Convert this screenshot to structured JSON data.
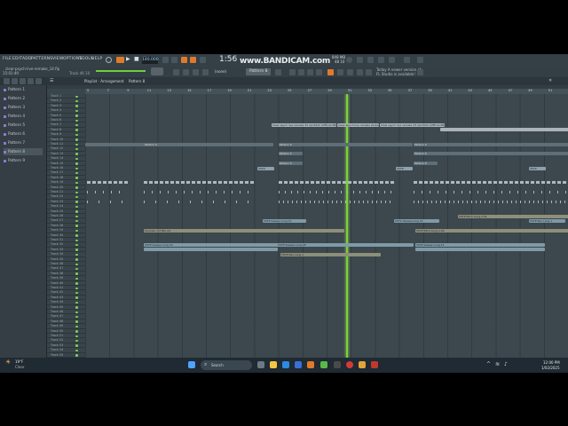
{
  "watermark": "www.BANDICAM.com",
  "menu": {
    "items": [
      "FILE",
      "EDIT",
      "ADD",
      "PATTERNS",
      "VIEW",
      "OPTIONS",
      "TOOLS",
      "HELP"
    ]
  },
  "transport": {
    "tempo": "140.000",
    "time": "1:56",
    "pattern_label": "Pattern 8",
    "snap_label": "(none)"
  },
  "hint_bar": {
    "file": "clear-psych-live-remake_14.flp",
    "time": "15:01:49",
    "track_hint": "Track 46 10"
  },
  "news": {
    "line1": "Today  A newer version of",
    "line2": "FL Studio is available!"
  },
  "monitor": {
    "mem": "848 MB",
    "cpu": "48 10"
  },
  "playlist": {
    "title": "Playlist - Arrangement",
    "pattern": "Pattern 8",
    "ruler": [
      "5",
      "7",
      "9",
      "11",
      "13",
      "15",
      "17",
      "19",
      "21",
      "23",
      "25",
      "27",
      "29",
      "31",
      "33",
      "35",
      "37",
      "39",
      "41",
      "43",
      "45",
      "47",
      "49",
      "51"
    ]
  },
  "patterns": [
    "Pattern 1",
    "Pattern 2",
    "Pattern 3",
    "Pattern 4",
    "Pattern 5",
    "Pattern 6",
    "Pattern 7",
    "Pattern 8",
    "Pattern 9"
  ],
  "selected_pattern": "Pattern 8",
  "tracks": [
    "Track 1",
    "Track 2",
    "Track 3",
    "Track 4",
    "Track 5",
    "Track 6",
    "Track 7",
    "Track 8",
    "Track 9",
    "Track 10",
    "Track 11",
    "Track 12",
    "Track 13",
    "Track 14",
    "Track 15",
    "Track 16",
    "Track 17",
    "Track 18",
    "Track 19",
    "Track 20",
    "Track 21",
    "Track 22",
    "Track 23",
    "Track 24",
    "Track 25",
    "Track 26",
    "Track 27",
    "Track 28",
    "Track 29",
    "Track 30",
    "Track 31",
    "Track 32",
    "Track 33",
    "Track 34",
    "Track 35",
    "Track 36",
    "Track 37",
    "Track 38",
    "Track 39",
    "Track 40",
    "Track 41",
    "Track 42",
    "Track 43",
    "Track 44",
    "Track 45",
    "Track 46",
    "Track 47",
    "Track 48",
    "Track 49",
    "Track 50",
    "Track 51",
    "Track 52",
    "Track 53",
    "Track 54",
    "Track 55"
  ],
  "clips": {
    "audio_a": "Claw spych live remake 32 Apr2022 (Official PROMO) wav",
    "audio_b": "Clear spych live remake (Kuba) spych",
    "audio_c": "Claw spych live remake 33 Apr2022 (Official PROMO) wav",
    "pattern_clip": "Pattern 4",
    "pattern_8": "Pattern 8",
    "pattern_9": "Pattern 9",
    "pattern_5": "Pattern 5",
    "pattern_6": "Pattern 6",
    "auto_vst": "VSTP",
    "auto_a": "VSTP Pitch Long 2.01",
    "auto_b": "VSTP Sweep Long 21",
    "auto_c": "VST2 Sweep Long 15",
    "auto_d": "VSTP Rev Long 1",
    "auto_e": "Vocoder 1/3 Mix (2)",
    "auto_f": "VSTP Pitch Long 2.02",
    "auto_g": "VSTP Sweep Long 19",
    "auto_h": "VSTP Sweep Long 28"
  },
  "taskbar": {
    "weather_temp": "19°F",
    "weather_desc": "Clear",
    "search_placeholder": "Search",
    "clock_time": "12:00 PM",
    "clock_date": "1/02/2025"
  },
  "colors": {
    "playhead": "#7bd232",
    "accent": "#e07a2a",
    "background": "#000000"
  }
}
